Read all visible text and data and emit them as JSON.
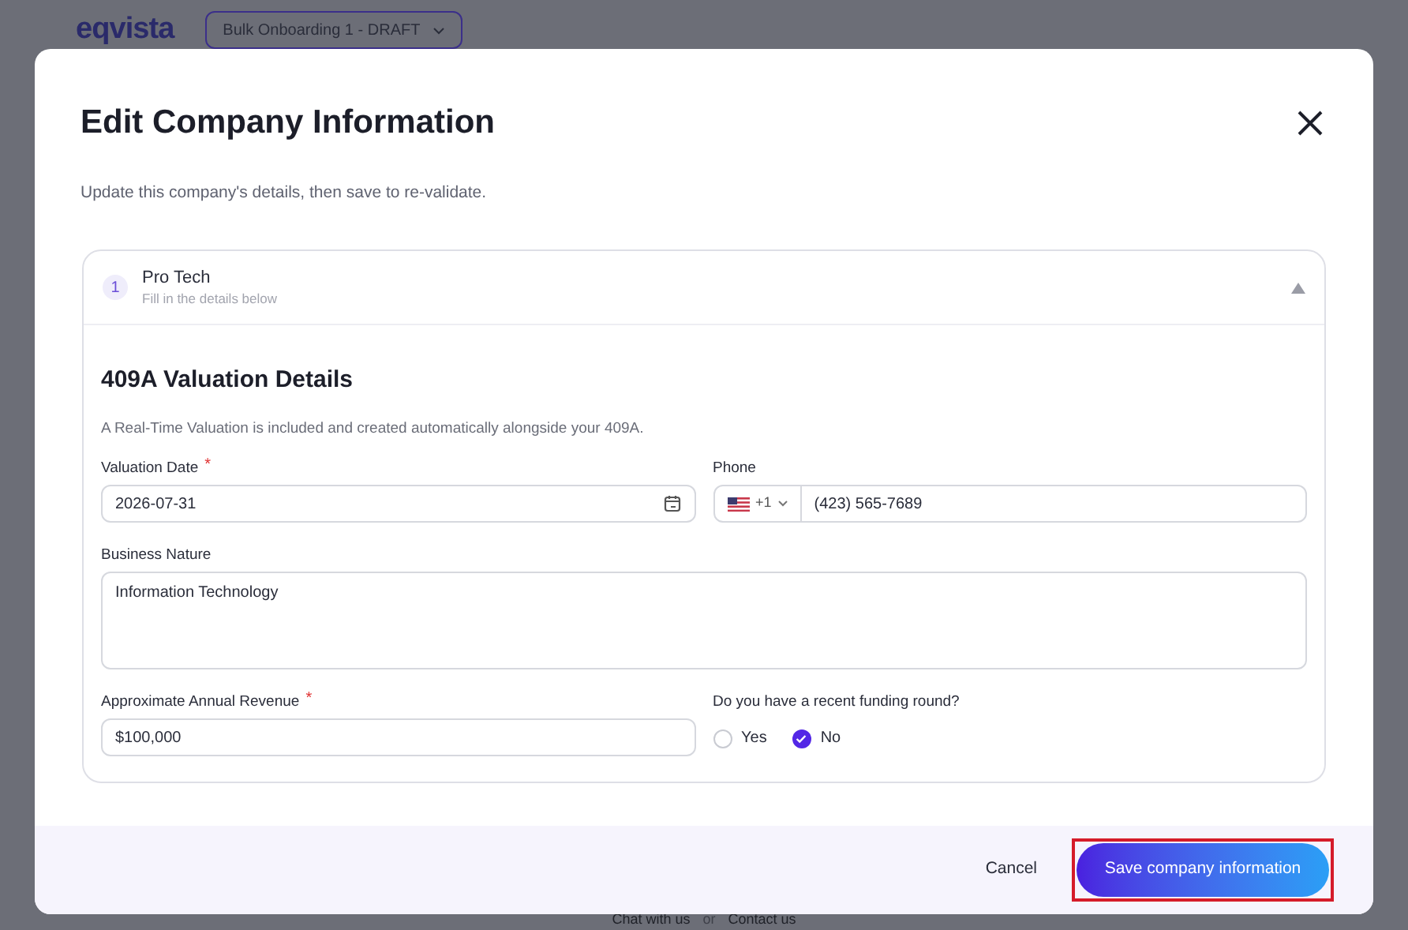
{
  "background_page": {
    "logo": "eqvista",
    "onboarding_dropdown": "Bulk Onboarding 1 - DRAFT",
    "footer": {
      "chat_link": "Chat with us",
      "separator": "or",
      "contact_link": "Contact us"
    }
  },
  "dialog": {
    "required_mark": "*",
    "title": "Edit Company Information",
    "subtitle": "Update this company's details, then save to re-validate.",
    "company": {
      "number": "1",
      "name": "Pro Tech",
      "hint": "Fill in the details below",
      "expanded": true
    },
    "section": {
      "title": "409A Valuation Details",
      "description": "A Real-Time Valuation is included and created automatically alongside your 409A."
    },
    "fields": [
      {
        "kind": "date",
        "label": "Valuation Date",
        "required": true,
        "value": "2026-07-31"
      },
      {
        "kind": "phone",
        "label": "Phone",
        "required": false,
        "country_code": "+1",
        "value": "(423) 565-7689"
      },
      {
        "kind": "textarea",
        "label": "Business Nature",
        "required": false,
        "value": "Information Technology"
      },
      {
        "kind": "text",
        "label": "Approximate Annual Revenue",
        "required": true,
        "value": "$100,000"
      },
      {
        "kind": "radio",
        "label": "Do you have a recent funding round?",
        "required": false,
        "options": [
          {
            "label": "Yes",
            "selected": false
          },
          {
            "label": "No",
            "selected": true
          }
        ]
      }
    ],
    "buttons": {
      "cancel": "Cancel",
      "save": "Save company information",
      "save_highlighted": true
    }
  }
}
